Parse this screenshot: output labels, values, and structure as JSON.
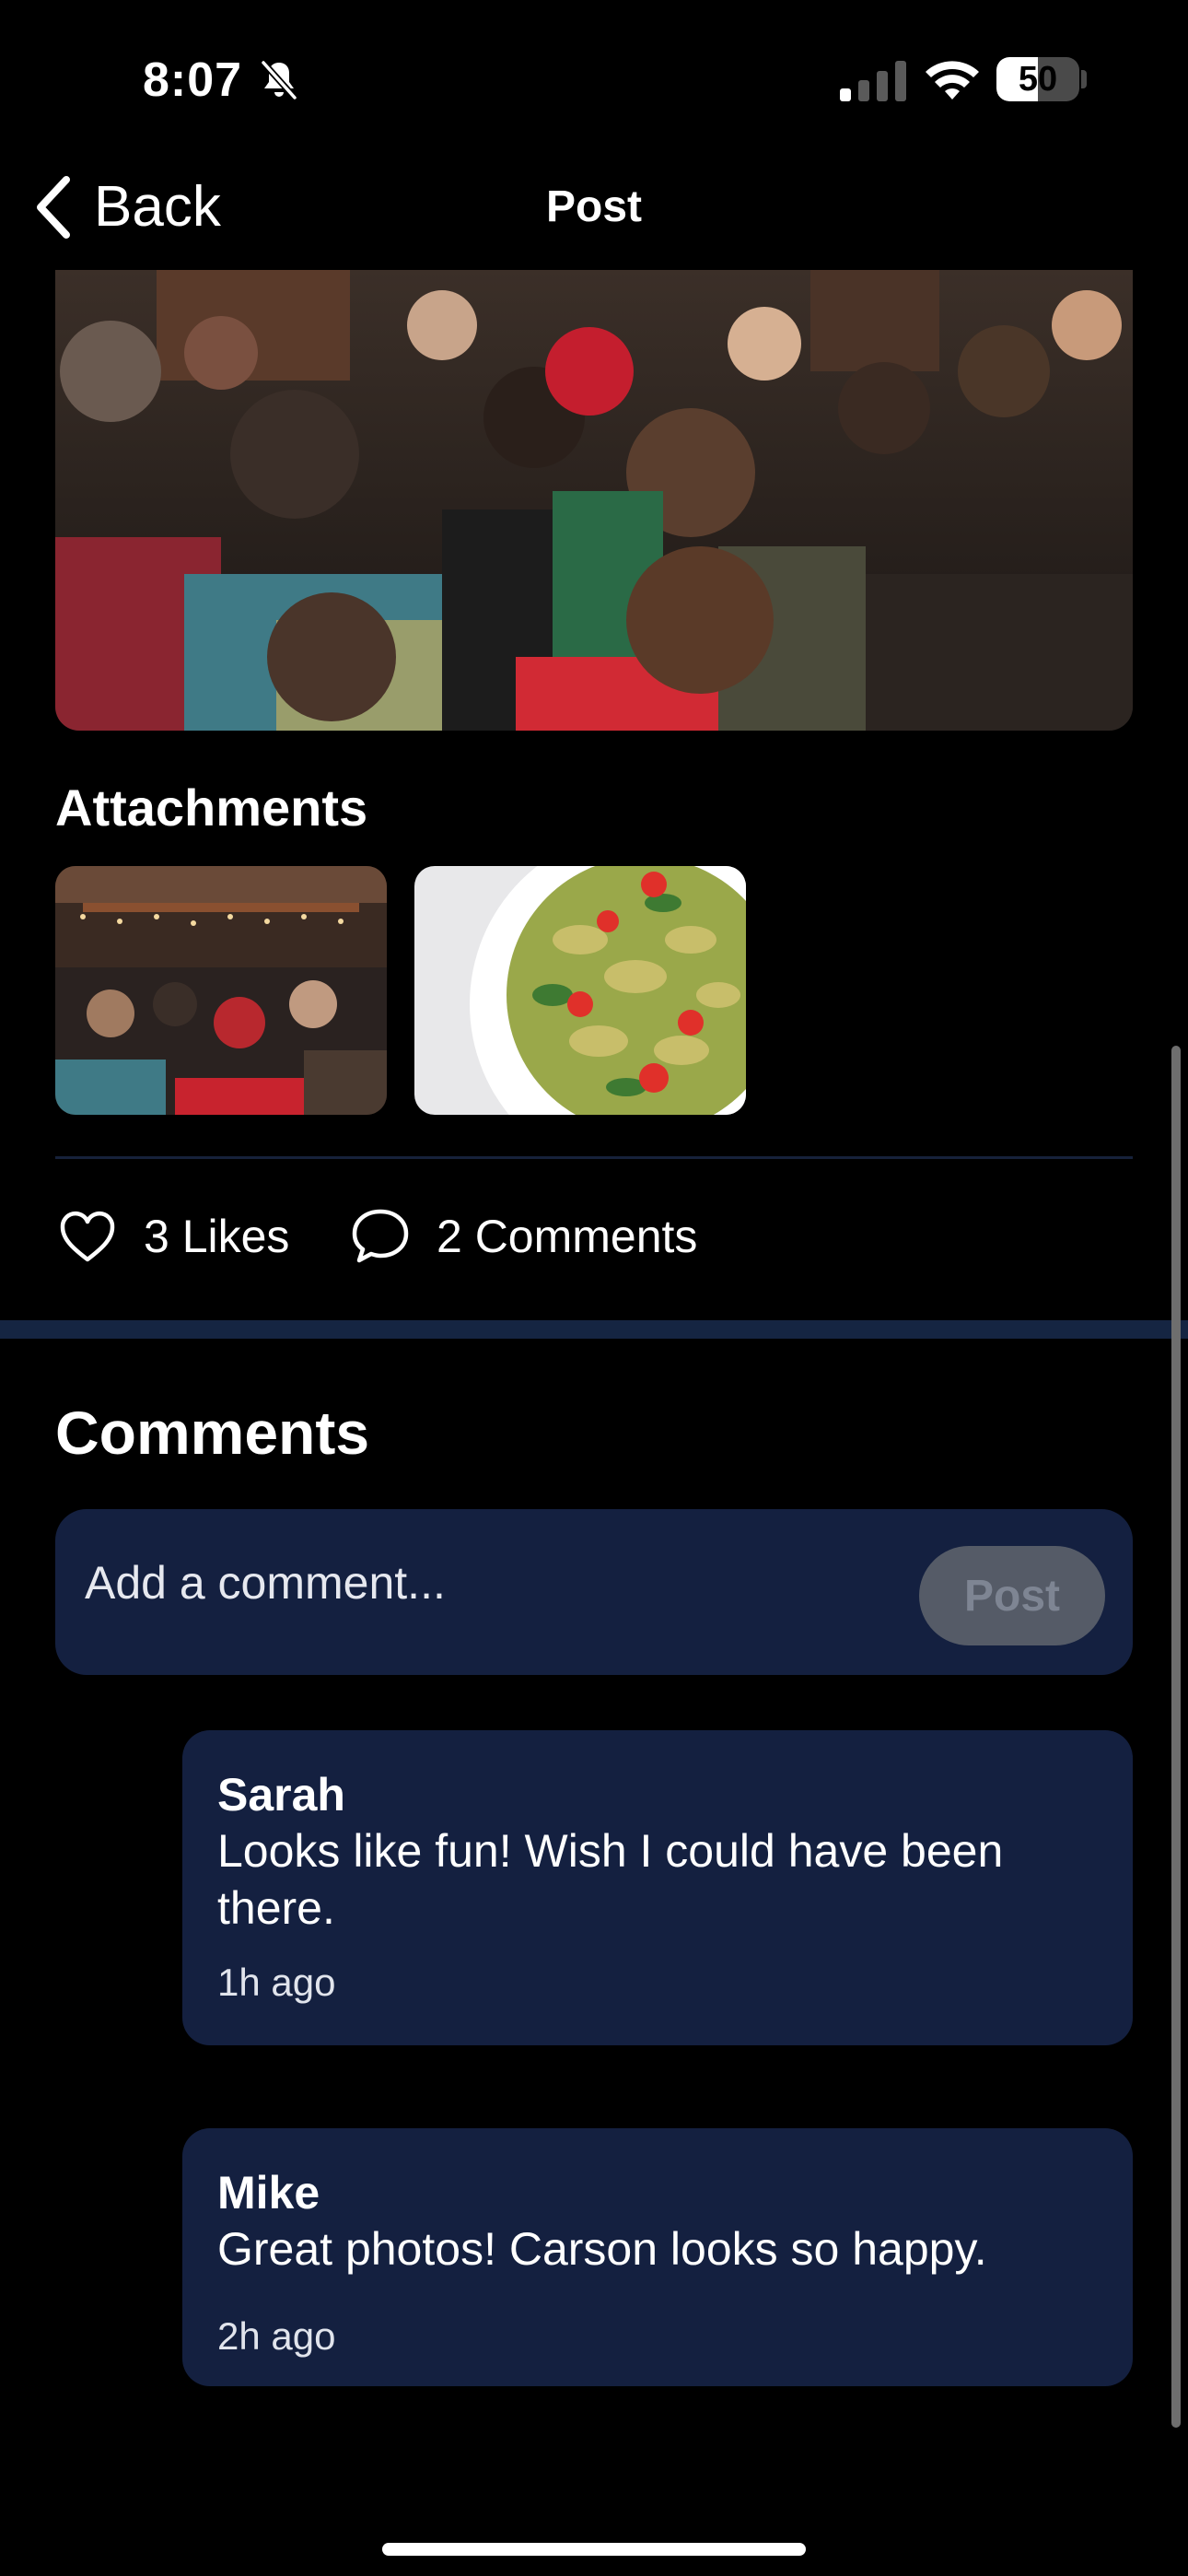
{
  "status_bar": {
    "time": "8:07",
    "battery_level": "50",
    "battery_fraction": 0.5,
    "icons": [
      "bell-slash-icon",
      "cellular-signal-icon",
      "wifi-icon",
      "battery-icon"
    ]
  },
  "nav": {
    "back_label": "Back",
    "title": "Post",
    "back_icon": "chevron-left-icon"
  },
  "attachments": {
    "heading": "Attachments"
  },
  "actions": {
    "likes_label": "3 Likes",
    "likes_icon": "heart-outline-icon",
    "comments_label": "2 Comments",
    "comments_icon": "speech-bubble-icon"
  },
  "comments": {
    "heading": "Comments",
    "input_placeholder": "Add a comment...",
    "post_label": "Post",
    "items": [
      {
        "author": "Sarah",
        "text": "Looks like fun! Wish I could have been there.",
        "time": "1h ago"
      },
      {
        "author": "Mike",
        "text": "Great photos! Carson looks so happy.",
        "time": "2h ago"
      }
    ]
  },
  "colors": {
    "background": "#000000",
    "card": "#142040",
    "band": "#152542",
    "divider": "#16213a",
    "post_button_disabled": "#555b67"
  }
}
